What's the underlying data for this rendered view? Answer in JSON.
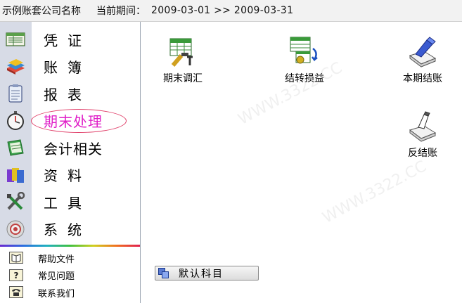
{
  "header": {
    "company_name": "示例账套公司名称",
    "period_label": "当前期间：",
    "period_value": "2009-03-01 >> 2009-03-31"
  },
  "sidebar": {
    "nav": [
      {
        "label": "凭证",
        "icon": "voucher-icon"
      },
      {
        "label": "账簿",
        "icon": "ledger-books-icon"
      },
      {
        "label": "报表",
        "icon": "report-icon"
      },
      {
        "label": "期末处理",
        "icon": "stopwatch-icon",
        "active": true
      },
      {
        "label": "会计相关",
        "icon": "accounting-notebook-icon"
      },
      {
        "label": "资料",
        "icon": "folders-icon"
      },
      {
        "label": "工具",
        "icon": "tools-icon"
      },
      {
        "label": "系统",
        "icon": "system-icon"
      }
    ],
    "help": [
      {
        "label": "帮助文件",
        "icon": "book-icon"
      },
      {
        "label": "常见问题",
        "icon": "question-icon"
      },
      {
        "label": "联系我们",
        "icon": "telephone-icon"
      }
    ]
  },
  "main": {
    "tiles": [
      {
        "label": "期末调汇",
        "icon": "exchange-adjust-icon"
      },
      {
        "label": "结转损益",
        "icon": "carry-forward-icon"
      },
      {
        "label": "本期结账",
        "icon": "close-period-icon"
      },
      {
        "label": "反结账",
        "icon": "reverse-close-icon"
      }
    ],
    "default_subject_button": "默认科目"
  },
  "colors": {
    "active_label": "#e020c8",
    "active_oval": "#e0406a",
    "nav_strip": "#d7dbe6"
  }
}
